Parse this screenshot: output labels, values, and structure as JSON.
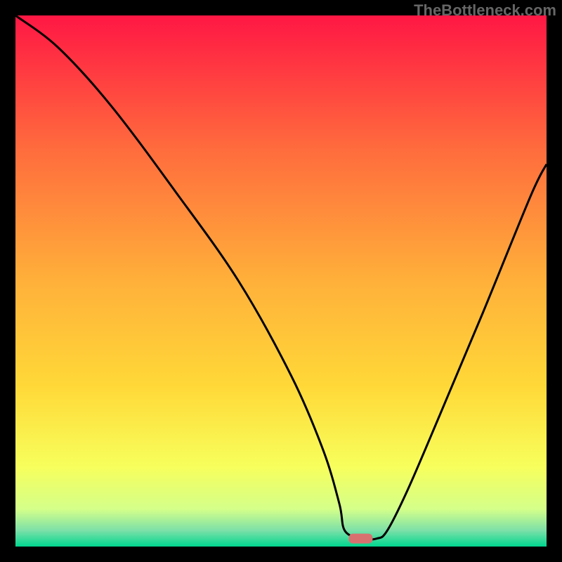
{
  "watermark": "TheBottleneck.com",
  "chart_data": {
    "type": "line",
    "title": "",
    "xlabel": "",
    "ylabel": "",
    "xlim": [
      0,
      100
    ],
    "ylim": [
      0,
      100
    ],
    "series": [
      {
        "name": "bottleneck-curve",
        "x": [
          0,
          8,
          18,
          30,
          42,
          52,
          58,
          61,
          62,
          65,
          68,
          70,
          74,
          80,
          88,
          97,
          100
        ],
        "values": [
          100,
          94,
          83,
          67,
          50,
          32,
          18,
          8,
          3,
          1.5,
          1.5,
          3,
          11,
          25,
          44,
          66,
          72
        ]
      }
    ],
    "marker": {
      "x": 65,
      "y": 1.5,
      "color": "#d97070"
    },
    "gradient_stops": [
      {
        "offset": 0,
        "color": "#ff1744"
      },
      {
        "offset": 0.25,
        "color": "#ff6b3d"
      },
      {
        "offset": 0.5,
        "color": "#ffb03a"
      },
      {
        "offset": 0.7,
        "color": "#ffd938"
      },
      {
        "offset": 0.85,
        "color": "#f7ff5c"
      },
      {
        "offset": 0.93,
        "color": "#d4ff8a"
      },
      {
        "offset": 0.97,
        "color": "#7be0a8"
      },
      {
        "offset": 1.0,
        "color": "#00d68f"
      }
    ],
    "frame_color": "#000000",
    "frame_inset": 22,
    "curve_stroke": "#000000"
  }
}
